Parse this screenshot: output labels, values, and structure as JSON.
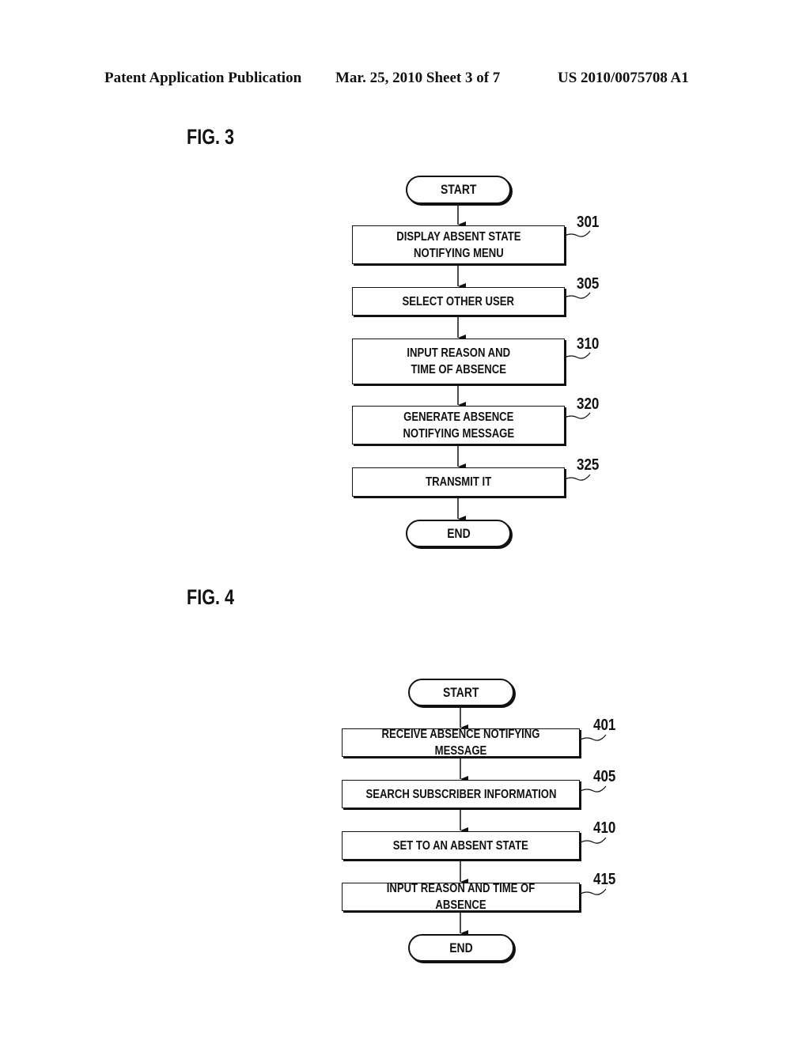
{
  "header": {
    "publication": "Patent Application Publication",
    "date_sheet": "Mar. 25, 2010  Sheet 3 of 7",
    "patent_number": "US 2010/0075708 A1"
  },
  "fig3": {
    "title": "FIG. 3",
    "start": "START",
    "end": "END",
    "steps": [
      {
        "ref": "301",
        "label": "DISPLAY ABSENT STATE\nNOTIFYING MENU"
      },
      {
        "ref": "305",
        "label": "SELECT OTHER USER"
      },
      {
        "ref": "310",
        "label": "INPUT REASON AND\nTIME OF ABSENCE"
      },
      {
        "ref": "320",
        "label": "GENERATE ABSENCE\nNOTIFYING MESSAGE"
      },
      {
        "ref": "325",
        "label": "TRANSMIT IT"
      }
    ]
  },
  "fig4": {
    "title": "FIG. 4",
    "start": "START",
    "end": "END",
    "steps": [
      {
        "ref": "401",
        "label": "RECEIVE ABSENCE NOTIFYING MESSAGE"
      },
      {
        "ref": "405",
        "label": "SEARCH SUBSCRIBER INFORMATION"
      },
      {
        "ref": "410",
        "label": "SET TO AN ABSENT STATE"
      },
      {
        "ref": "415",
        "label": "INPUT REASON AND TIME OF ABSENCE"
      }
    ]
  }
}
